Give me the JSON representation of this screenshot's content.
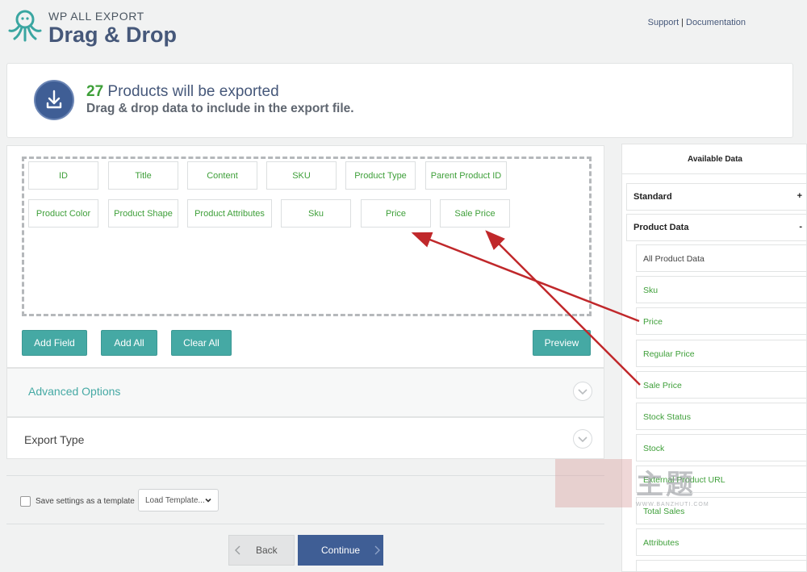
{
  "header": {
    "brand_small": "WP ALL EXPORT",
    "title": "Drag & Drop",
    "support_link": "Support",
    "separator": "|",
    "documentation_link": "Documentation"
  },
  "banner": {
    "count": "27",
    "title_rest": " Products will be exported",
    "subtitle": "Drag & drop data to include in the export file."
  },
  "fields": [
    {
      "label": "ID"
    },
    {
      "label": "Title"
    },
    {
      "label": "Content"
    },
    {
      "label": "SKU"
    },
    {
      "label": "Product Type"
    },
    {
      "label": "Parent Product ID"
    },
    {
      "label": "Product Color"
    },
    {
      "label": "Product Shape"
    },
    {
      "label": "Product Attributes"
    },
    {
      "label": "Sku"
    },
    {
      "label": "Price"
    },
    {
      "label": "Sale Price"
    }
  ],
  "buttons": {
    "add_field": "Add Field",
    "add_all": "Add All",
    "clear_all": "Clear All",
    "preview": "Preview",
    "back": "Back",
    "continue": "Continue"
  },
  "sections": {
    "advanced_options": "Advanced Options",
    "export_type": "Export Type"
  },
  "footer": {
    "save_template_label": "Save settings as a template",
    "load_template_value": "Load Template..."
  },
  "available_data": {
    "title": "Available Data",
    "standard": {
      "label": "Standard",
      "toggle": "+"
    },
    "product_data": {
      "label": "Product Data",
      "toggle": "-"
    },
    "items": [
      {
        "label": "All Product Data"
      },
      {
        "label": "Sku"
      },
      {
        "label": "Price"
      },
      {
        "label": "Regular Price"
      },
      {
        "label": "Sale Price"
      },
      {
        "label": "Stock Status"
      },
      {
        "label": "Stock"
      },
      {
        "label": "External Product URL"
      },
      {
        "label": "Total Sales"
      },
      {
        "label": "Attributes"
      }
    ]
  },
  "watermark": {
    "text": "主题",
    "url": "WWW.BANZHUTI.COM"
  },
  "colors": {
    "navy": "#3f5e95",
    "teal": "#45a9a4",
    "green": "#3e9f39",
    "arrow_red": "#c0282b"
  }
}
